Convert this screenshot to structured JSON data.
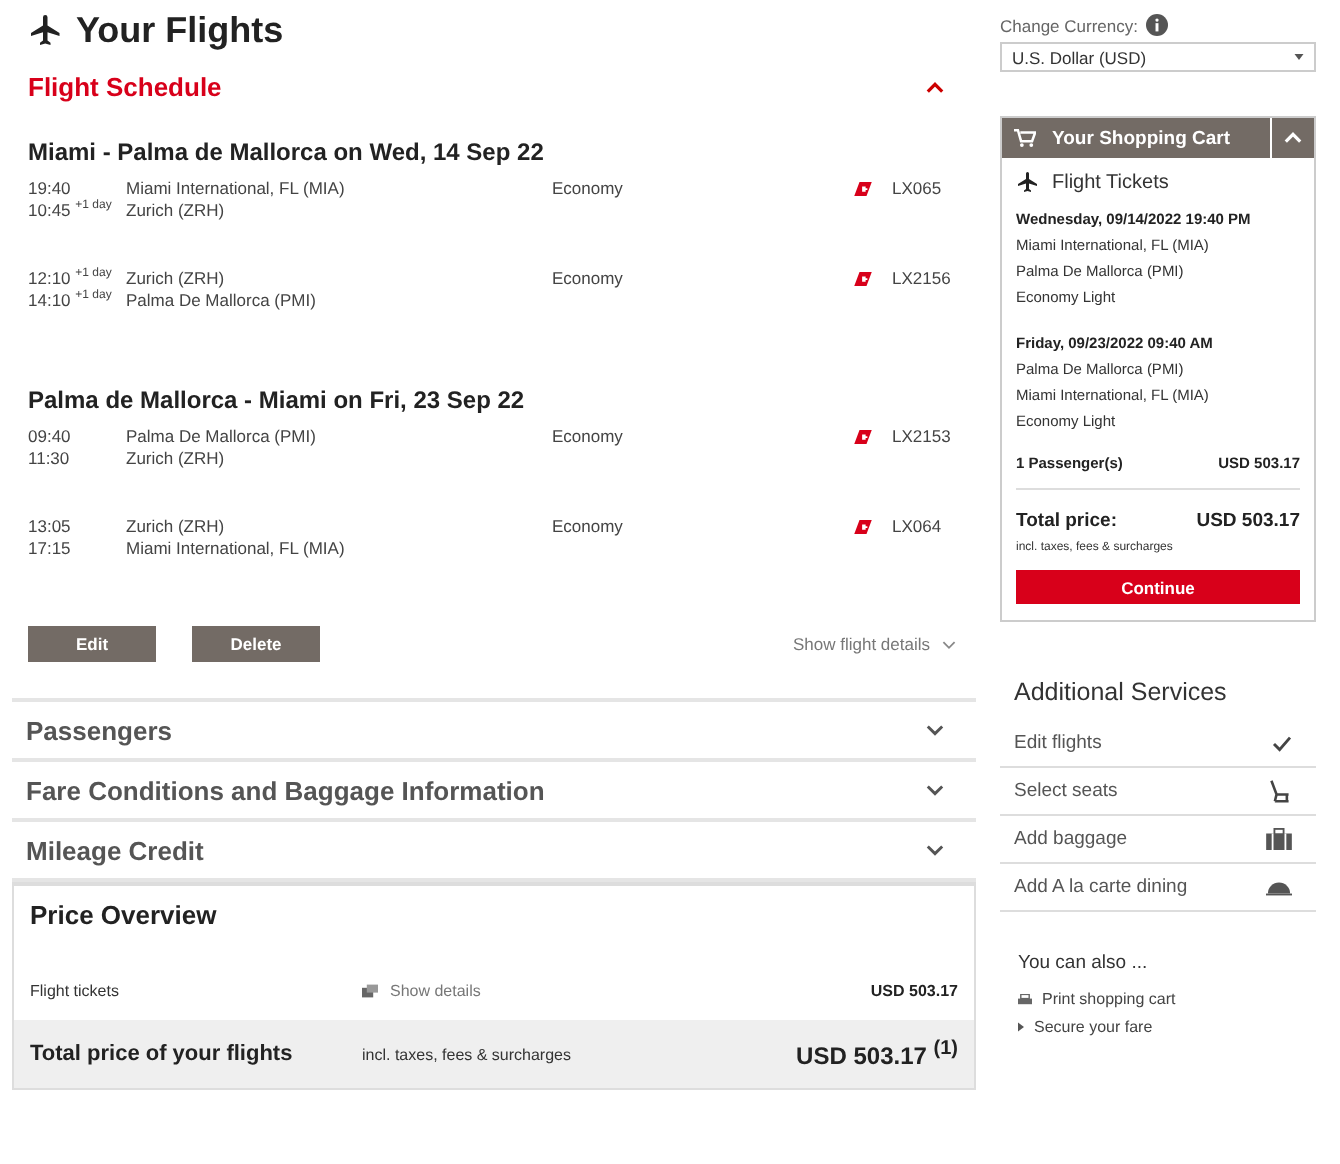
{
  "page_title": "Your Flights",
  "schedule": {
    "title": "Flight Schedule",
    "expanded": true,
    "journeys": [
      {
        "heading": "Miami - Palma de Mallorca on Wed, 14 Sep 22",
        "segments": [
          {
            "dep_time": "19:40",
            "arr_time": "10:45 $^{+1 day}$",
            "from": "Miami International, FL (MIA)",
            "to": "Zurich (ZRH)",
            "cabin": "Economy",
            "flight": "LX065"
          },
          {
            "dep_time": "12:10 $^{+1 day}$",
            "arr_time": "14:10 $^{+1 day}$",
            "from": "Zurich (ZRH)",
            "to": "Palma De Mallorca (PMI)",
            "cabin": "Economy",
            "flight": "LX2156"
          }
        ]
      },
      {
        "heading": "Palma de Mallorca - Miami on Fri, 23 Sep 22",
        "segments": [
          {
            "dep_time": "09:40",
            "arr_time": "11:30",
            "from": "Palma De Mallorca (PMI)",
            "to": "Zurich (ZRH)",
            "cabin": "Economy",
            "flight": "LX2153"
          },
          {
            "dep_time": "13:05",
            "arr_time": "17:15",
            "from": "Zurich (ZRH)",
            "to": "Miami International, FL (MIA)",
            "cabin": "Economy",
            "flight": "LX064"
          }
        ]
      }
    ],
    "buttons": [
      "Edit",
      "Delete"
    ],
    "details_link": "Show flight details"
  },
  "sections": [
    {
      "title": "Passengers",
      "expanded": false
    },
    {
      "title": "Fare Conditions and Baggage Information",
      "expanded": false
    },
    {
      "title": "Mileage Credit",
      "expanded": false
    }
  ],
  "price_overview": {
    "title": "Price Overview",
    "item_label": "Flight tickets",
    "details_link": "Show details",
    "item_price": "USD 503.17",
    "total_label": "Total price of your flights",
    "total_note": "incl. taxes, fees & surcharges",
    "total_price": "USD 503.17 $^{(1)}$"
  },
  "currency": {
    "label": "Change Currency:",
    "value": "U.S. Dollar (USD)"
  },
  "cart": {
    "title": "Your Shopping Cart",
    "expanded": true,
    "section": "Flight Tickets",
    "trips": [
      {
        "date": "Wednesday, 09/14/2022 19:40 PM",
        "lines": [
          "Miami International, FL (MIA)",
          "Palma De Mallorca (PMI)",
          "Economy Light"
        ]
      },
      {
        "date": "Friday, 09/23/2022 09:40 AM",
        "lines": [
          "Palma De Mallorca (PMI)",
          "Miami International, FL (MIA)",
          "Economy Light"
        ]
      }
    ],
    "passengers": "1 Passenger(s)",
    "passengers_price": "USD 503.17",
    "total_label": "Total price:",
    "total_price": "USD 503.17",
    "total_note": "incl. taxes, fees & surcharges",
    "button": "Continue"
  },
  "services": {
    "title": "Additional Services",
    "items": [
      {
        "label": "Edit flights",
        "kind": "check"
      },
      {
        "label": "Select seats",
        "kind": "seat"
      },
      {
        "label": "Add baggage",
        "kind": "baggage"
      },
      {
        "label": "Add A la carte dining",
        "kind": "dining"
      }
    ]
  },
  "also": {
    "title": "You can also ...",
    "links": [
      {
        "label": "Print shopping cart",
        "kind": "print"
      },
      {
        "label": "Secure your fare",
        "kind": "arrow"
      }
    ]
  }
}
